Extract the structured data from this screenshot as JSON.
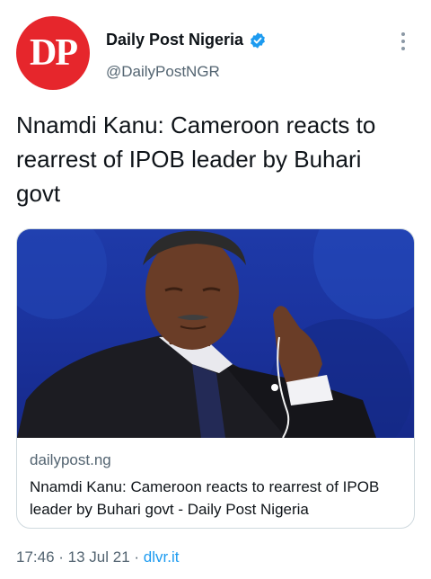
{
  "author": {
    "avatar_text": "DP",
    "display_name": "Daily Post Nigeria",
    "handle": "@DailyPostNGR",
    "verified": true
  },
  "tweet": {
    "text": "Nnamdi Kanu: Cameroon reacts to rearrest of IPOB leader by Buhari govt"
  },
  "card": {
    "domain": "dailypost.ng",
    "title": "Nnamdi Kanu: Cameroon reacts to rearrest of IPOB leader by Buhari govt - Daily Post Nigeria"
  },
  "meta": {
    "time": "17:46",
    "separator": " · ",
    "date": "13 Jul 21",
    "source": "dlvr.it"
  },
  "colors": {
    "avatar_bg": "#e6262c",
    "verified": "#1d9bf0",
    "link": "#1d9bf0",
    "secondary_text": "#536471",
    "card_image_bg": "#1b34a0"
  },
  "icons": {
    "verified": "verified-badge-icon",
    "more": "more-options-icon"
  }
}
